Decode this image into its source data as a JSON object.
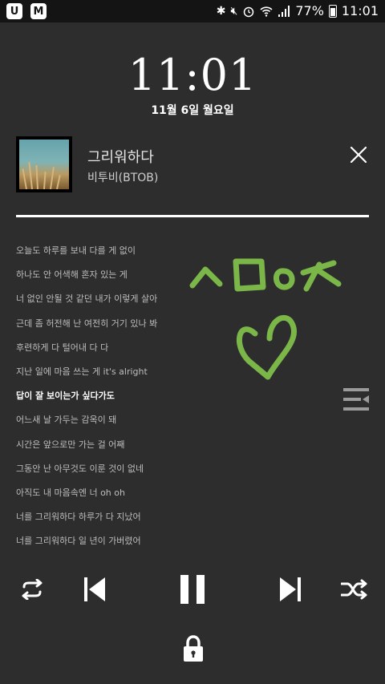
{
  "status_bar": {
    "app_icons": [
      "U",
      "M"
    ],
    "battery": "77%",
    "time": "11:01"
  },
  "lockscreen": {
    "time": "11:01",
    "date": "11월 6일 월요일"
  },
  "player": {
    "song_title": "그리워하다",
    "artist": "비투비(BTOB)",
    "progress_fraction": 1.0,
    "lyrics": [
      "오늘도 하루를 보내 다를 게 없이",
      "하나도 안 어색해 혼자 있는 게",
      "너 없인 안될 것 같던 내가 이렇게 살아",
      "근데 좀 허전해 난 여전히 거기 있나 봐",
      "후련하게 다 털어내 다 다",
      "지난 일에 마음 쓰는 게 it's alright",
      "답이 잘 보이는가 싶다가도",
      "어느새 날 가두는 감옥이 돼",
      "시간은 앞으로만 가는 걸 어째",
      "그동안 난 아무것도 이룬 것이 없네",
      "아직도 내 마음속엔 너 oh oh",
      "너를 그리워하다 하루가 다 지났어",
      "너를 그리워하다 일 년이 가버렸어"
    ],
    "current_lyric_index": 6
  },
  "colors": {
    "background": "#2d2d2d",
    "status_bar": "#141414",
    "doodle": "#7ab648"
  },
  "icons": [
    "repeat-icon",
    "previous-icon",
    "pause-icon",
    "next-icon",
    "shuffle-icon",
    "lock-icon",
    "close-icon",
    "lyrics-menu-icon"
  ]
}
